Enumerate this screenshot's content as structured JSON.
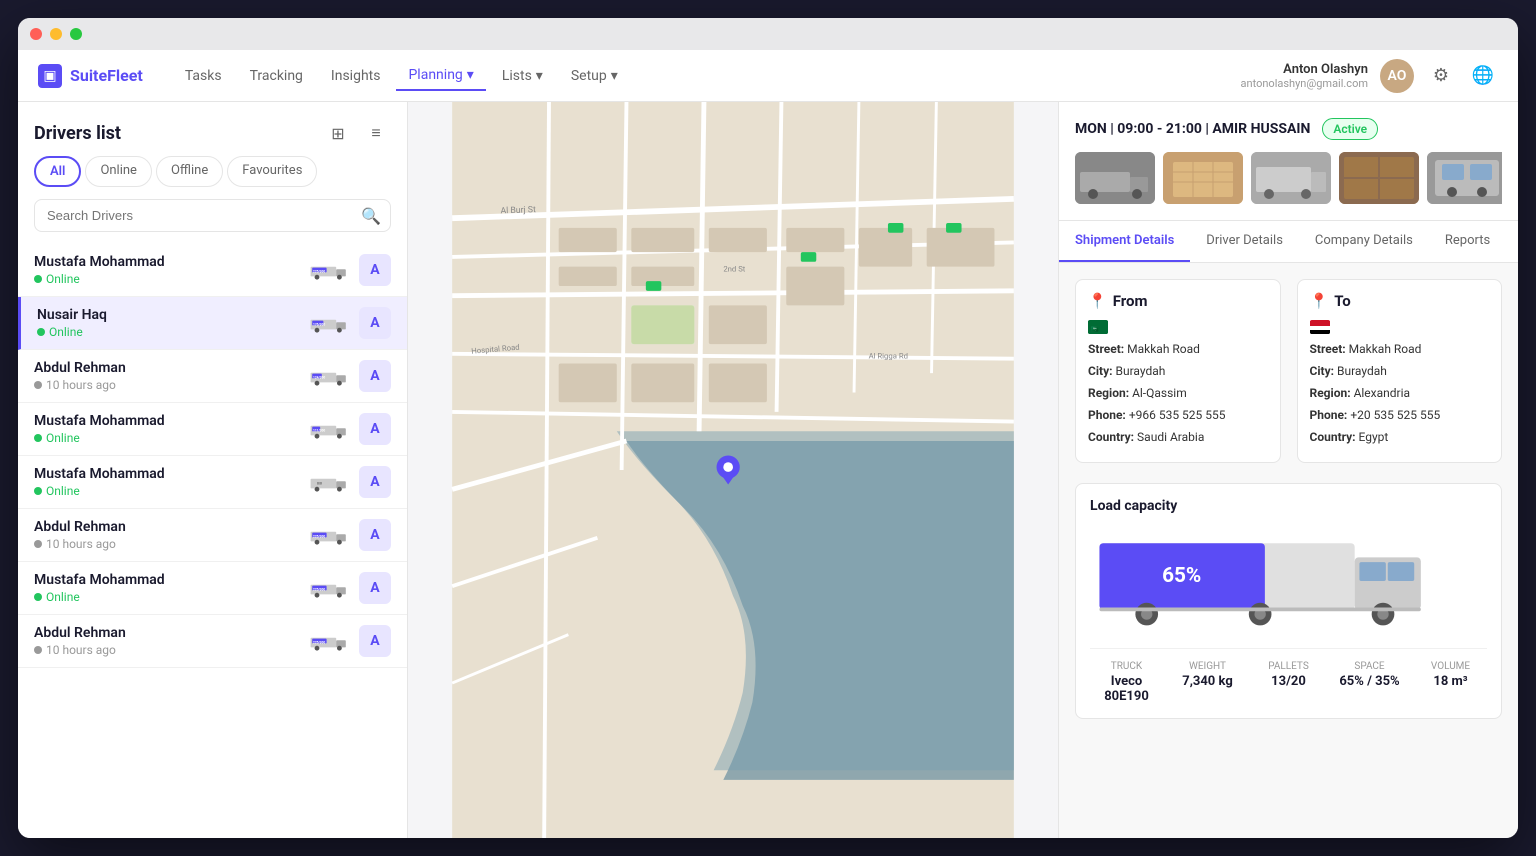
{
  "window": {
    "title": "SuiteFleet"
  },
  "logo": {
    "text": "SuiteFleet",
    "icon": "▣"
  },
  "nav": {
    "items": [
      {
        "label": "Tasks",
        "active": false
      },
      {
        "label": "Tracking",
        "active": false
      },
      {
        "label": "Insights",
        "active": false
      },
      {
        "label": "Planning",
        "active": true,
        "has_dropdown": true
      },
      {
        "label": "Lists",
        "active": false,
        "has_dropdown": true
      },
      {
        "label": "Setup",
        "active": false,
        "has_dropdown": true
      }
    ],
    "user": {
      "name": "Anton Olashyn",
      "email": "antonolashyn@gmail.com"
    }
  },
  "left_panel": {
    "title": "Drivers list",
    "filter_tabs": [
      "All",
      "Online",
      "Offline",
      "Favourites"
    ],
    "active_tab": "All",
    "search_placeholder": "Search Drivers",
    "drivers": [
      {
        "name": "Mustafa Mohammad",
        "status": "Online",
        "capacity": "225/300",
        "online": true
      },
      {
        "name": "Nusair Haq",
        "status": "Online",
        "capacity": "176/300",
        "online": true,
        "selected": true
      },
      {
        "name": "Abdul Rehman",
        "status": "10 hours ago",
        "capacity": "124/300",
        "online": false
      },
      {
        "name": "Mustafa Mohammad",
        "status": "Online",
        "capacity": "111/300",
        "online": true
      },
      {
        "name": "Mustafa Mohammad",
        "status": "Online",
        "capacity": "0/0",
        "online": true
      },
      {
        "name": "Abdul Rehman",
        "status": "10 hours ago",
        "capacity": "225/300",
        "online": false
      },
      {
        "name": "Mustafa Mohammad",
        "status": "Online",
        "capacity": "225/300",
        "online": true
      },
      {
        "name": "Abdul Rehman",
        "status": "10 hours ago",
        "capacity": "225/300",
        "online": false
      }
    ]
  },
  "right_panel": {
    "schedule": "MON | 09:00 - 21:00 | AMIR HUSSAIN",
    "status": "Active",
    "tabs": [
      "Shipment Details",
      "Driver Details",
      "Company Details",
      "Reports"
    ],
    "active_tab": "Shipment Details",
    "from": {
      "title": "From",
      "country_code": "SA",
      "street": "Makkah Road",
      "city": "Buraydah",
      "region": "Al-Qassim",
      "phone": "+966 535 525 555",
      "country": "Saudi Arabia"
    },
    "to": {
      "title": "To",
      "country_code": "EG",
      "street": "Makkah Road",
      "city": "Buraydah",
      "region": "Alexandria",
      "phone": "+20 535 525 555",
      "country": "Egypt"
    },
    "load_capacity": {
      "title": "Load capacity",
      "percent": 65,
      "percent_label": "65%",
      "stats": [
        {
          "label": "Truck",
          "value": "Iveco 80E190"
        },
        {
          "label": "Weight",
          "value": "7,340 kg"
        },
        {
          "label": "Pallets",
          "value": "13/20"
        },
        {
          "label": "Space",
          "value": "65% / 35%"
        },
        {
          "label": "Volume",
          "value": "18 m³"
        }
      ]
    }
  }
}
